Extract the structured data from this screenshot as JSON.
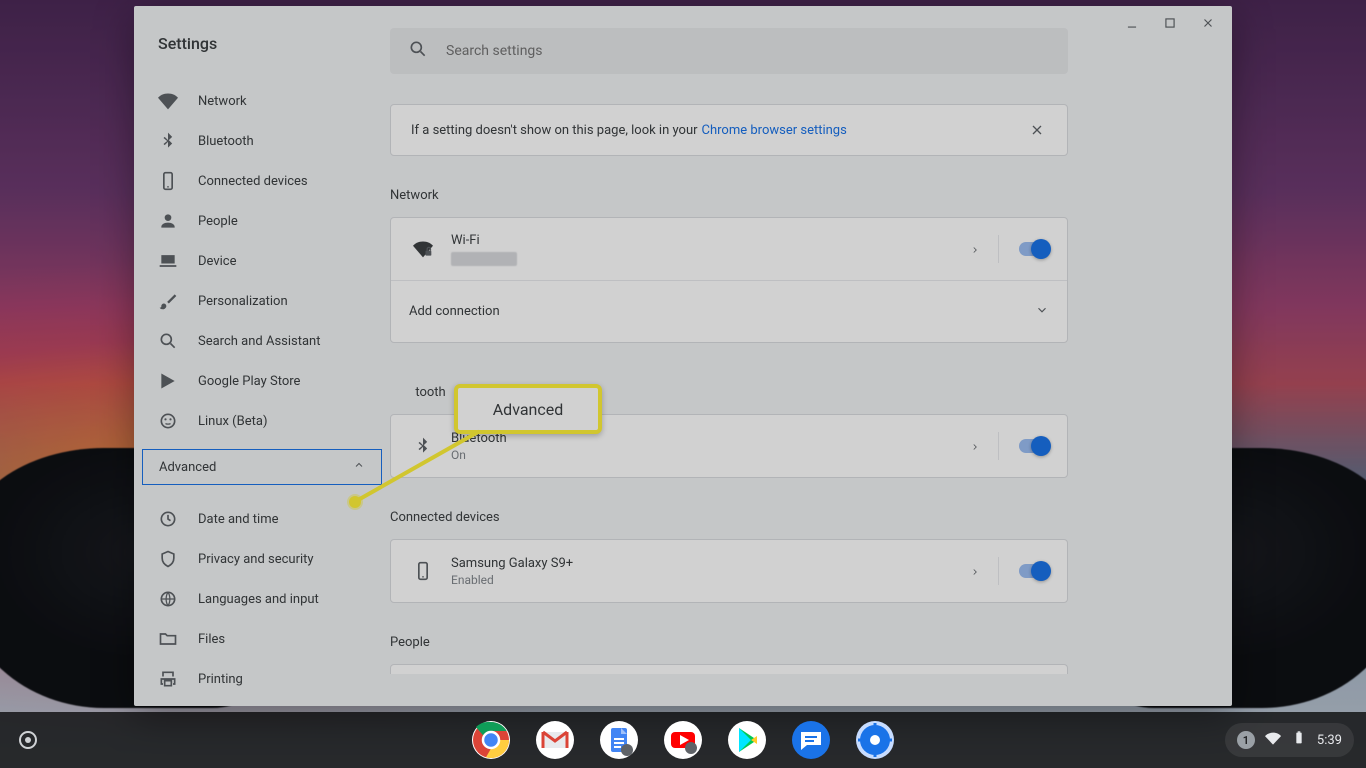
{
  "header": {
    "title": "Settings"
  },
  "search": {
    "placeholder": "Search settings"
  },
  "banner": {
    "text": "If a setting doesn't show on this page, look in your ",
    "link": "Chrome browser settings"
  },
  "sidebar": {
    "items": [
      {
        "id": "network",
        "label": "Network"
      },
      {
        "id": "bluetooth",
        "label": "Bluetooth"
      },
      {
        "id": "connected-devices",
        "label": "Connected devices"
      },
      {
        "id": "people",
        "label": "People"
      },
      {
        "id": "device",
        "label": "Device"
      },
      {
        "id": "personalization",
        "label": "Personalization"
      },
      {
        "id": "search-assistant",
        "label": "Search and Assistant"
      },
      {
        "id": "play-store",
        "label": "Google Play Store"
      },
      {
        "id": "linux-beta",
        "label": "Linux (Beta)"
      }
    ],
    "advanced_label": "Advanced",
    "advanced_items": [
      {
        "id": "date-time",
        "label": "Date and time"
      },
      {
        "id": "privacy-security",
        "label": "Privacy and security"
      },
      {
        "id": "languages-input",
        "label": "Languages and input"
      },
      {
        "id": "files",
        "label": "Files"
      },
      {
        "id": "printing",
        "label": "Printing"
      }
    ]
  },
  "sections": {
    "network": {
      "title": "Network",
      "wifi": {
        "title": "Wi-Fi",
        "toggled": true
      },
      "add_connection": "Add connection"
    },
    "bluetooth_partial": "tooth",
    "bluetooth": {
      "title": "Bluetooth",
      "row_title": "Bluetooth",
      "row_sub": "On",
      "toggled": true
    },
    "connected": {
      "title": "Connected devices",
      "row_title": "Samsung Galaxy S9+",
      "row_sub": "Enabled",
      "toggled": true
    },
    "people": {
      "title": "People"
    }
  },
  "annotation": {
    "label": "Advanced"
  },
  "tray": {
    "notif_count": "1",
    "time": "5:39"
  },
  "colors": {
    "accent": "#1a73e8",
    "highlight": "#fff23a"
  }
}
